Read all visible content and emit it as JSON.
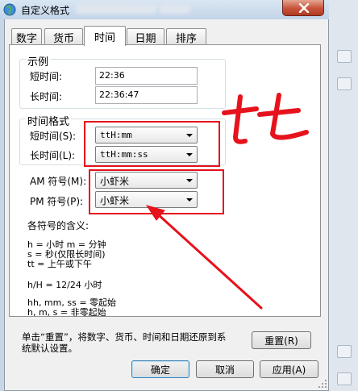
{
  "window": {
    "title": "自定义格式",
    "close_icon": "close-icon"
  },
  "tabs": [
    {
      "label": "数字"
    },
    {
      "label": "货币"
    },
    {
      "label": "时间",
      "selected": true
    },
    {
      "label": "日期"
    },
    {
      "label": "排序"
    }
  ],
  "example": {
    "label": "示例",
    "short_label": "短时间:",
    "short_value": "22:36",
    "long_label": "长时间:",
    "long_value": "22:36:47"
  },
  "formats": {
    "label": "时间格式",
    "short_label": "短时间(S):",
    "short_value": "ttH:mm",
    "long_label": "长时间(L):",
    "long_value": "ttH:mm:ss"
  },
  "ampm": {
    "am_label": "AM 符号(M):",
    "am_value": "小虾米",
    "pm_label": "PM 符号(P):",
    "pm_value": "小虾米"
  },
  "legend": {
    "title": "各符号的含义:",
    "line1": "h = 小时   m = 分钟",
    "line2": "s = 秒(仅限长时间)",
    "line3": "tt = 上午或下午",
    "line4": "h/H = 12/24 小时",
    "line5": "hh, mm, ss = 零起始",
    "line6": "h, m, s = 非零起始"
  },
  "reset": {
    "text_line1": "单击“重置”，将数字、货币、时间和日期还原到系",
    "text_line2": "统默认设置。",
    "button": "重置(R)"
  },
  "footer": {
    "ok": "确定",
    "cancel": "取消",
    "apply": "应用(A)"
  },
  "annotation": {
    "handwriting": "tt",
    "color": "#e6121c"
  }
}
